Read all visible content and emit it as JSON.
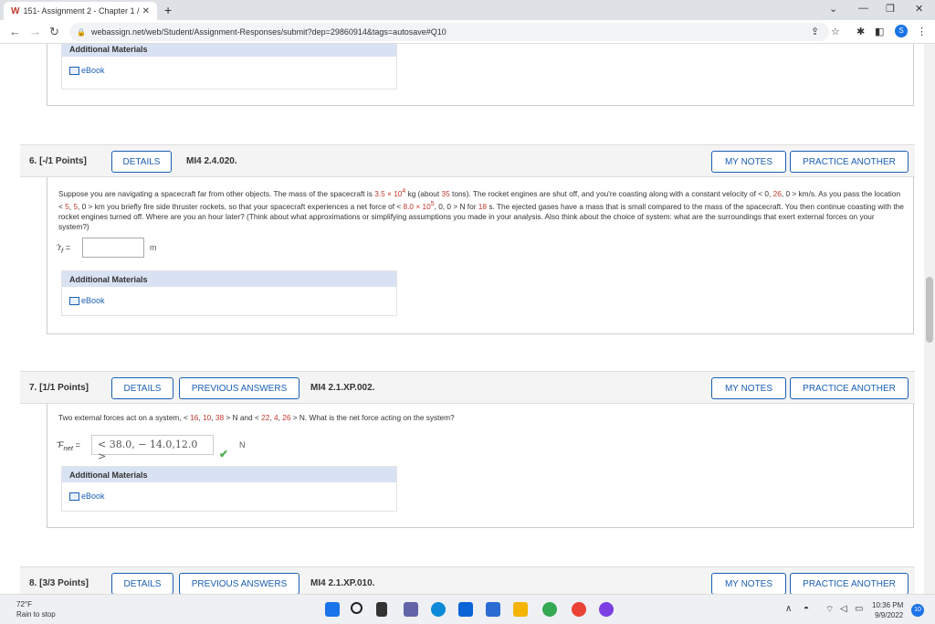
{
  "browser": {
    "tab_title": "151- Assignment 2 - Chapter 1 / ",
    "favicon": "W",
    "url": "webassign.net/web/Student/Assignment-Responses/submit?dep=29860914&tags=autosave#Q10",
    "profile_initial": "S"
  },
  "q5_tail": {
    "additional_materials": "Additional Materials",
    "ebook": "eBook"
  },
  "q6": {
    "number": "6.  [-/1 Points]",
    "details": "DETAILS",
    "code": "MI4 2.4.020.",
    "my_notes": "MY NOTES",
    "practice_another": "PRACTICE ANOTHER",
    "text_parts": {
      "p1": "Suppose you are navigating a spacecraft far from other objects. The mass of the spacecraft is ",
      "mass": "3.5 × 10",
      "mass_exp": "4",
      "p2": " kg (about ",
      "tons": "35",
      "p3": " tons). The rocket engines are shut off, and you're coasting along with a constant velocity of < 0, ",
      "vy": "26",
      "p4": ", 0 > km/s. As you pass the location < ",
      "x": "5",
      "p5": ", ",
      "y": "5",
      "p6": ", 0 > km you briefly fire side thruster rockets, so that your spacecraft experiences a net force of < ",
      "f": "8.0 × 10",
      "f_exp": "5",
      "p7": ", 0, 0 > N for ",
      "t": "18",
      "p8": " s. The ejected gases have a mass that is small compared to the mass of the spacecraft. You then continue coasting with the rocket engines turned off. Where are you an hour later? (Think about what approximations or simplifying assumptions you made in your analysis. Also think about the choice of system: what are the surroundings that exert external forces on your system?)"
    },
    "answer_label": "r",
    "answer_sub": "f",
    "answer_value": "",
    "unit": "m",
    "additional_materials": "Additional Materials",
    "ebook": "eBook"
  },
  "q7": {
    "number": "7.  [1/1 Points]",
    "details": "DETAILS",
    "previous_answers": "PREVIOUS ANSWERS",
    "code": "MI4 2.1.XP.002.",
    "my_notes": "MY NOTES",
    "practice_another": "PRACTICE ANOTHER",
    "text_parts": {
      "p1": "Two external forces act on a system, < ",
      "a1": "16",
      "p2": ", ",
      "a2": "10",
      "p3": ", ",
      "a3": "38",
      "p4": " > N and < ",
      "b1": "22",
      "p5": ", ",
      "b2": "4",
      "p6": ", ",
      "b3": "26",
      "p7": " > N. What is the net force acting on the system?"
    },
    "answer_label": "F",
    "answer_sub": "net",
    "answer_value": "< 38.0, − 14.0,12.0 >",
    "unit": "N",
    "additional_materials": "Additional Materials",
    "ebook": "eBook"
  },
  "q8": {
    "number": "8.  [3/3 Points]",
    "details": "DETAILS",
    "previous_answers": "PREVIOUS ANSWERS",
    "code": "MI4 2.1.XP.010.",
    "my_notes": "MY NOTES",
    "practice_another": "PRACTICE ANOTHER"
  },
  "taskbar": {
    "temp": "72°F",
    "weather_text": "Rain to stop",
    "time": "10:36 PM",
    "date": "9/9/2022",
    "notifications": "10"
  },
  "colors": {
    "accent": "#1a5fb4",
    "red_value": "#c0392b",
    "header_bg": "#d9e2f3"
  }
}
